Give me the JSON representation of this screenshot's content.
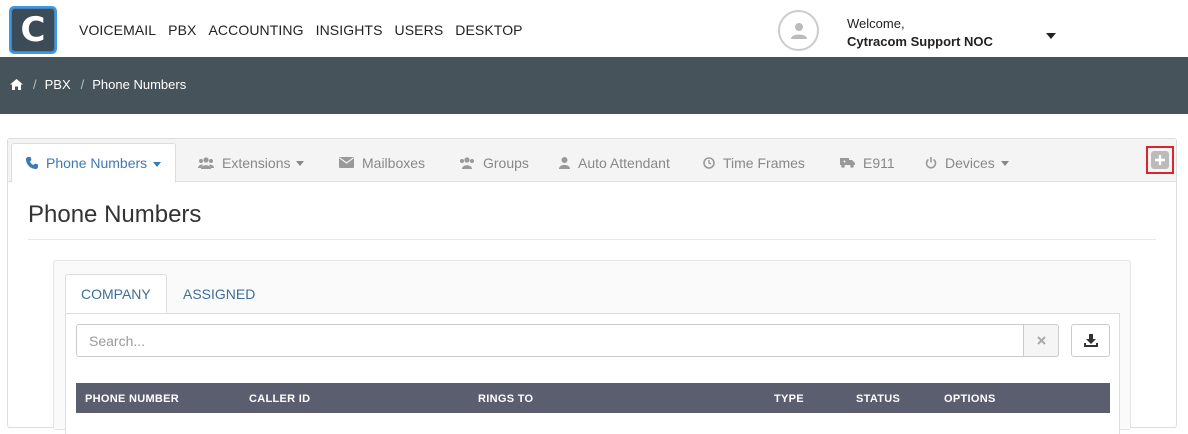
{
  "app": {
    "logo_letter": "C"
  },
  "nav": {
    "items": [
      "VOICEMAIL",
      "PBX",
      "ACCOUNTING",
      "INSIGHTS",
      "USERS",
      "DESKTOP"
    ]
  },
  "user": {
    "welcome": "Welcome,",
    "name": "Cytracom Support NOC"
  },
  "breadcrumb": {
    "items": [
      "PBX",
      "Phone Numbers"
    ],
    "separator": "/"
  },
  "tabs": [
    {
      "label": "Phone Numbers",
      "icon": "phone-icon",
      "active": true,
      "dropdown": true
    },
    {
      "label": "Extensions",
      "icon": "users-icon",
      "dropdown": true
    },
    {
      "label": "Mailboxes",
      "icon": "envelope-icon"
    },
    {
      "label": "Groups",
      "icon": "group-icon"
    },
    {
      "label": "Auto Attendant",
      "icon": "user-icon"
    },
    {
      "label": "Time Frames",
      "icon": "clock-icon"
    },
    {
      "label": "E911",
      "icon": "ambulance-icon"
    },
    {
      "label": "Devices",
      "icon": "power-icon",
      "dropdown": true
    }
  ],
  "page": {
    "title": "Phone Numbers"
  },
  "subtabs": [
    {
      "label": "COMPANY",
      "active": true
    },
    {
      "label": "ASSIGNED"
    }
  ],
  "search": {
    "placeholder": "Search..."
  },
  "table": {
    "columns": [
      "PHONE NUMBER",
      "CALLER ID",
      "RINGS TO",
      "TYPE",
      "STATUS",
      "OPTIONS"
    ]
  },
  "colors": {
    "accent": "#3d79b4",
    "header_bar": "#46535b",
    "table_header": "#5a5e6e",
    "highlight": "#d9262a"
  }
}
